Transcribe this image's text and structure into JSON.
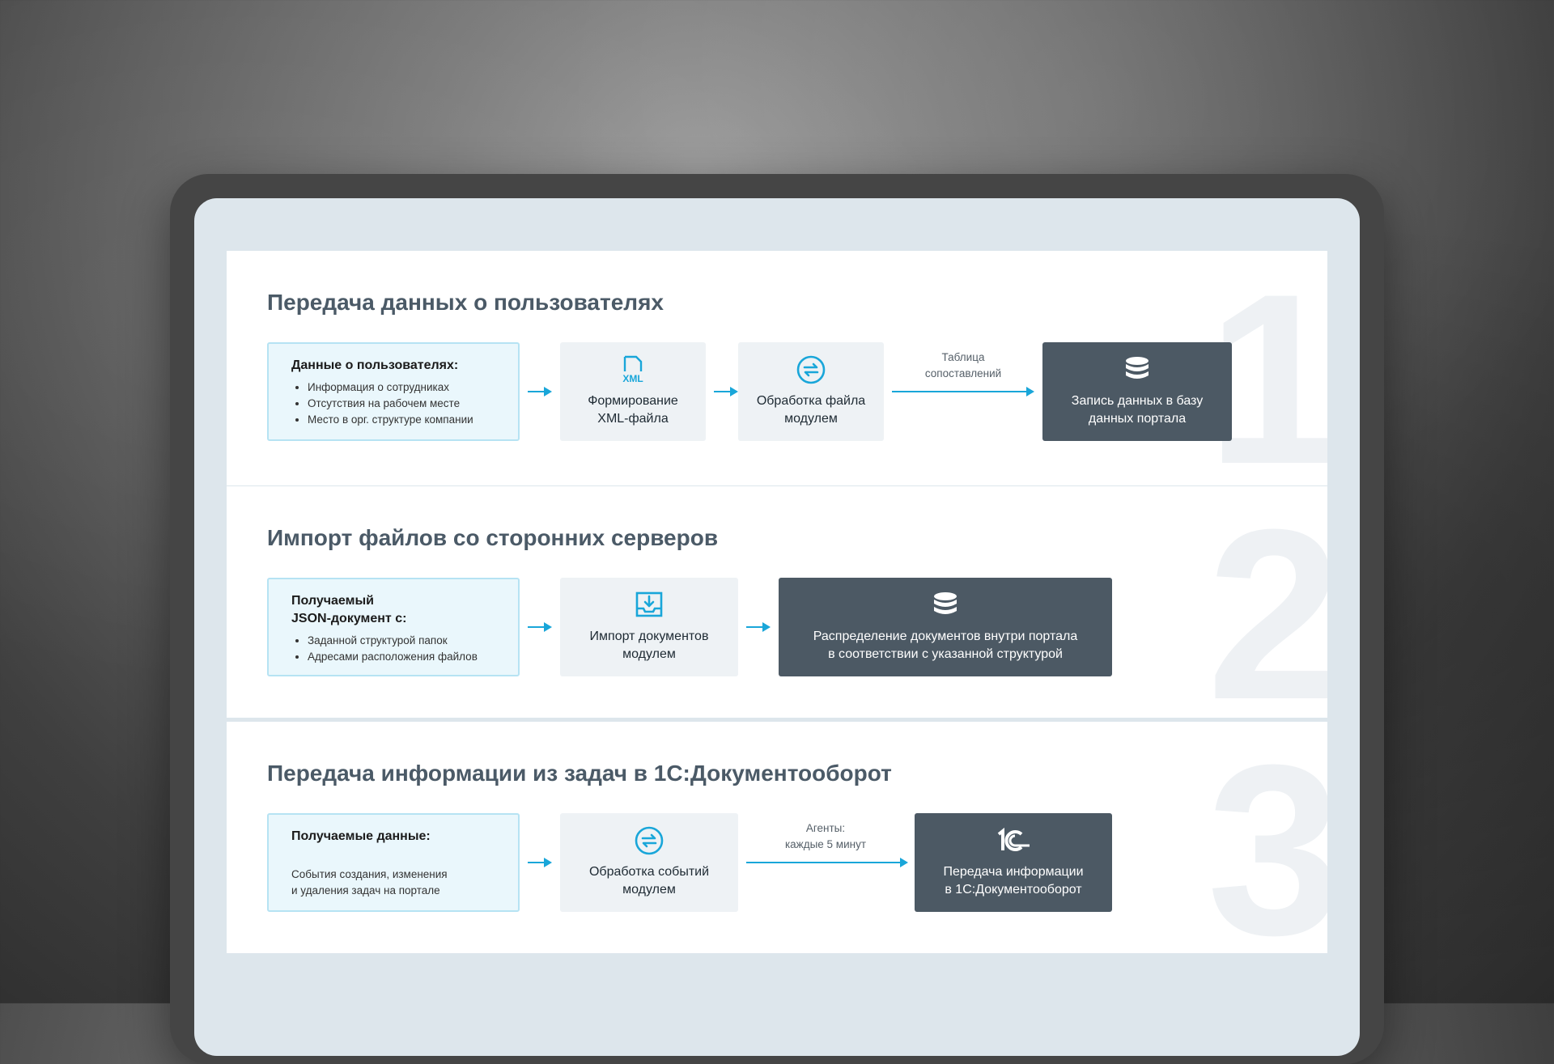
{
  "colors": {
    "accent": "#19a6d9",
    "dark_box": "#4c5964",
    "light_box": "#eef2f5",
    "source_box": "#eaf7fc",
    "title": "#4b5a67"
  },
  "sections": [
    {
      "number": "1",
      "title": "Передача данных о пользователях",
      "source": {
        "title": "Данные о пользователях:",
        "items": [
          "Информация о сотрудниках",
          "Отсутствия на рабочем месте",
          "Место в орг. структуре компании"
        ]
      },
      "steps": [
        {
          "label": "Формирование\nXML-файла",
          "icon": "xml-file-icon"
        },
        {
          "label": "Обработка файла\nмодулем",
          "icon": "sync-icon"
        }
      ],
      "arrow_label": "Таблица\nсопоставлений",
      "result": {
        "label": "Запись данных в базу\nданных портала",
        "icon": "database-icon"
      }
    },
    {
      "number": "2",
      "title": "Импорт файлов со сторонних серверов",
      "source": {
        "title": "Получаемый\nJSON-документ с:",
        "items": [
          "Заданной структурой папок",
          "Адресами расположения файлов"
        ]
      },
      "steps": [
        {
          "label": "Импорт документов\nмодулем",
          "icon": "import-tray-icon"
        }
      ],
      "result": {
        "label": "Распределение документов внутри портала\nв соответствии с указанной структурой",
        "icon": "database-icon"
      }
    },
    {
      "number": "3",
      "title": "Передача информации из задач в 1С:Документооборот",
      "source": {
        "title": "Получаемые данные:",
        "text": "События создания, изменения\nи удаления задач на портале"
      },
      "steps": [
        {
          "label": "Обработка событий\nмодулем",
          "icon": "sync-icon"
        }
      ],
      "arrow_label": "Агенты:\nкаждые 5 минут",
      "result": {
        "label": "Передача информации\nв 1С:Документооборот",
        "icon": "1c-logo-icon"
      }
    }
  ]
}
